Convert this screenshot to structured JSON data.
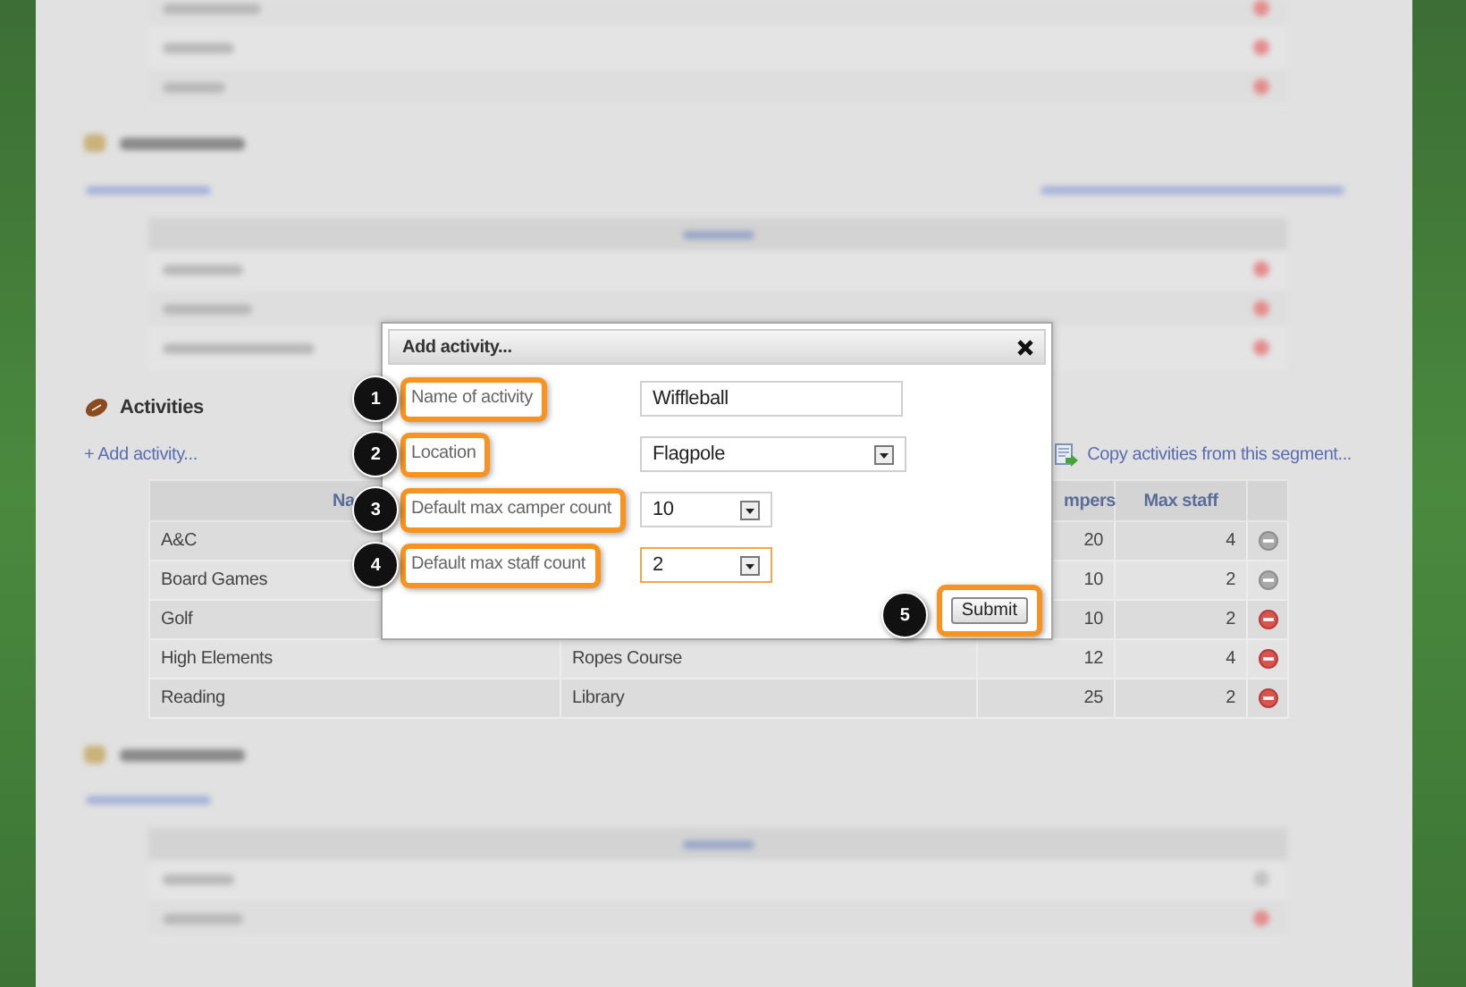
{
  "activities": {
    "title": "Activities",
    "add_link": "+ Add activity...",
    "copy_link": "Copy activities from this segment...",
    "table": {
      "columns": [
        "Na",
        "mpers",
        "Max staff"
      ],
      "rows": [
        {
          "name": "A&C",
          "max_campers": "20",
          "max_staff": "4",
          "remove_disabled": true
        },
        {
          "name": "Board Games",
          "max_campers": "10",
          "max_staff": "2",
          "remove_disabled": true
        },
        {
          "name": "Golf",
          "max_campers": "10",
          "max_staff": "2",
          "remove_disabled": false
        },
        {
          "name": "High Elements",
          "location": "Ropes Course",
          "max_campers": "12",
          "max_staff": "4",
          "remove_disabled": false
        },
        {
          "name": "Reading",
          "location": "Library",
          "max_campers": "25",
          "max_staff": "2",
          "remove_disabled": false
        }
      ]
    }
  },
  "dialog": {
    "title": "Add activity...",
    "fields": [
      {
        "callout": "1",
        "label": "Name of activity",
        "kind": "text",
        "value": "Wiffleball",
        "focused": false
      },
      {
        "callout": "2",
        "label": "Location",
        "kind": "select",
        "value": "Flagpole",
        "focused": false
      },
      {
        "callout": "3",
        "label": "Default max camper count",
        "kind": "small-select",
        "value": "10",
        "focused": false
      },
      {
        "callout": "4",
        "label": "Default max staff count",
        "kind": "small-select",
        "value": "2",
        "focused": true
      }
    ],
    "submit": {
      "callout": "5",
      "label": "Submit"
    }
  }
}
